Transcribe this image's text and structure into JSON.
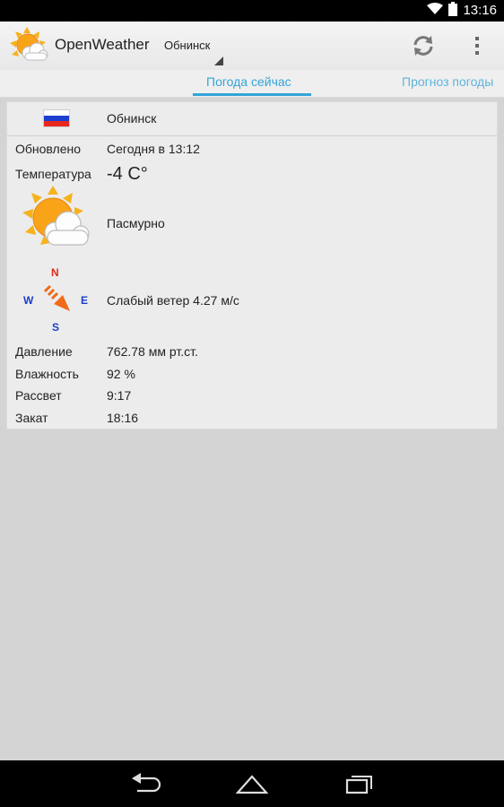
{
  "status_bar": {
    "time": "13:16",
    "icons": [
      "wifi-icon",
      "battery-icon"
    ]
  },
  "action_bar": {
    "app_title": "OpenWeather",
    "city_selected": "Обнинск",
    "icons": [
      "app-logo-icon",
      "refresh-icon",
      "overflow-menu-icon"
    ]
  },
  "tabs": {
    "active": "Погода сейчас",
    "next": "Прогноз погоды"
  },
  "weather": {
    "city": "Обнинск",
    "updated_label": "Обновлено",
    "updated_value": "Сегодня в 13:12",
    "temperature_label": "Температура",
    "temperature_value": "-4 C°",
    "condition": "Пасмурно",
    "wind": "Слабый ветер 4.27 м/с",
    "compass": {
      "n": "N",
      "e": "E",
      "s": "S",
      "w": "W"
    },
    "pressure_label": "Давление",
    "pressure_value": "762.78 мм рт.ст.",
    "humidity_label": "Влажность",
    "humidity_value": "92 %",
    "sunrise_label": "Рассвет",
    "sunrise_value": "9:17",
    "sunset_label": "Закат",
    "sunset_value": "18:16"
  },
  "colors": {
    "accent": "#33a4d8",
    "compass_north": "#e32b1b",
    "compass_other": "#1a3fc8",
    "wind_arrow": "#f06a18",
    "sun": "#f7b21c"
  },
  "nav_bar": {
    "icons": [
      "back-icon",
      "home-icon",
      "recent-apps-icon"
    ]
  }
}
